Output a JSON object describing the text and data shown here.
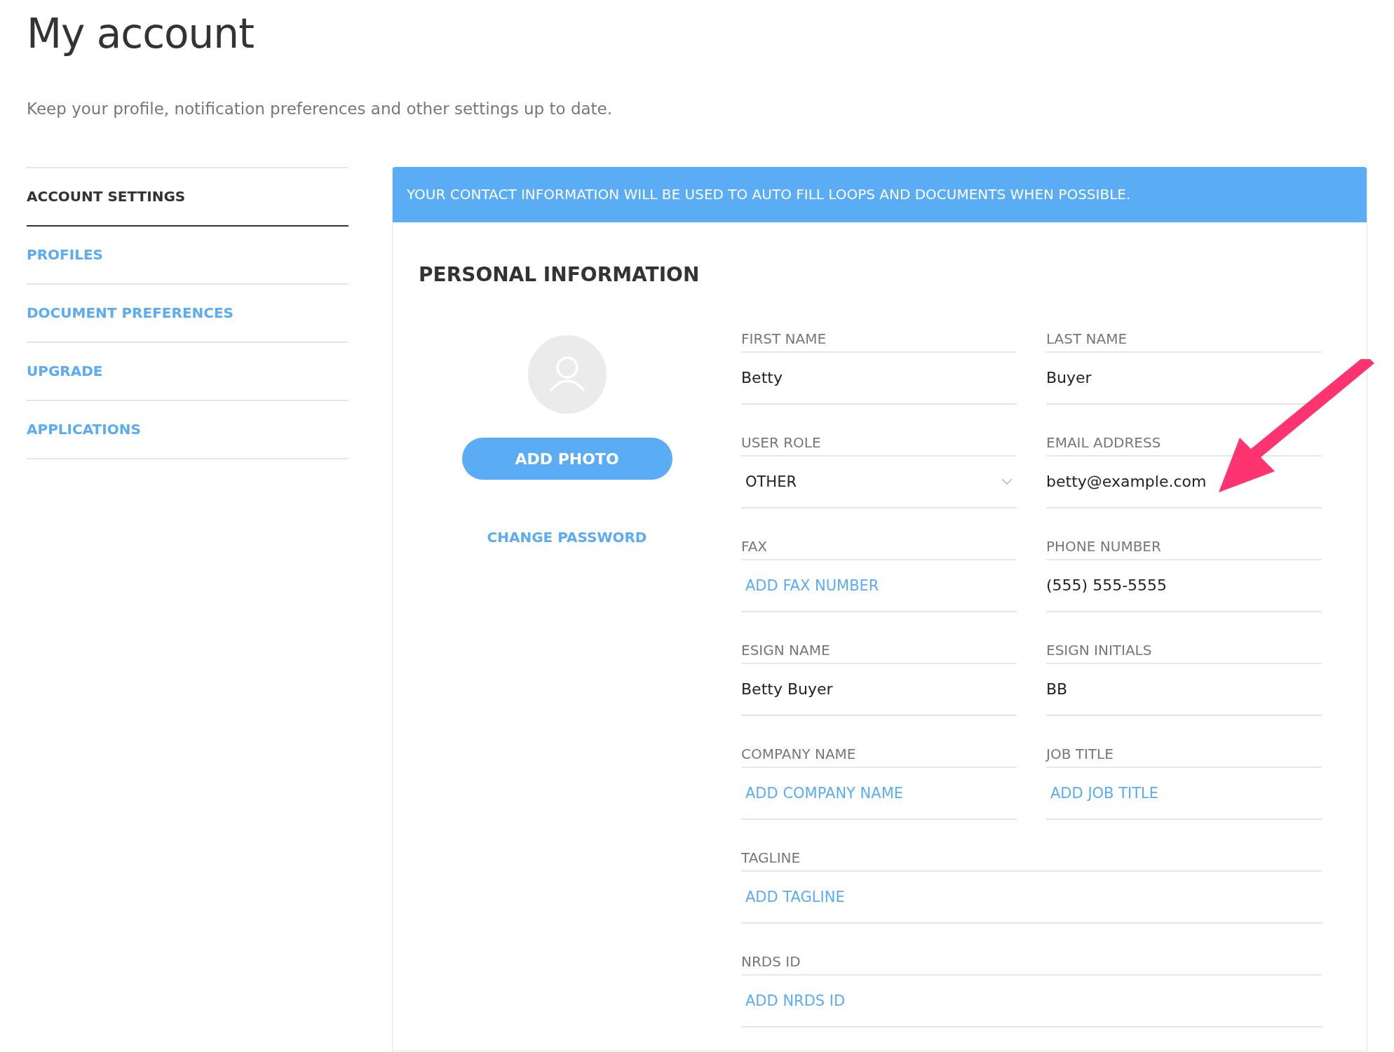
{
  "page": {
    "title": "My account",
    "subtitle": "Keep your profile, notification preferences and other settings up to date."
  },
  "sidebar": {
    "items": [
      {
        "label": "ACCOUNT SETTINGS",
        "selected": true
      },
      {
        "label": "PROFILES",
        "selected": false
      },
      {
        "label": "DOCUMENT PREFERENCES",
        "selected": false
      },
      {
        "label": "UPGRADE",
        "selected": false
      },
      {
        "label": "APPLICATIONS",
        "selected": false
      }
    ]
  },
  "banner": "YOUR CONTACT INFORMATION WILL BE USED TO AUTO FILL LOOPS AND DOCUMENTS WHEN POSSIBLE.",
  "section": {
    "title": "PERSONAL INFORMATION",
    "add_photo": "ADD PHOTO",
    "change_password": "CHANGE PASSWORD",
    "fields": [
      {
        "kind": "text",
        "label": "FIRST NAME",
        "value": "Betty",
        "wide": false
      },
      {
        "kind": "text",
        "label": "LAST NAME",
        "value": "Buyer",
        "wide": false
      },
      {
        "kind": "select",
        "label": "USER ROLE",
        "value": "OTHER",
        "wide": false
      },
      {
        "kind": "text",
        "label": "EMAIL ADDRESS",
        "value": "betty@example.com",
        "wide": false
      },
      {
        "kind": "text",
        "label": "FAX",
        "placeholder": "ADD FAX NUMBER",
        "wide": false
      },
      {
        "kind": "text",
        "label": "PHONE NUMBER",
        "value": "(555) 555-5555",
        "wide": false
      },
      {
        "kind": "text",
        "label": "ESIGN NAME",
        "value": "Betty Buyer",
        "wide": false
      },
      {
        "kind": "text",
        "label": "ESIGN INITIALS",
        "value": "BB",
        "wide": false
      },
      {
        "kind": "text",
        "label": "COMPANY NAME",
        "placeholder": "ADD COMPANY NAME",
        "wide": false
      },
      {
        "kind": "text",
        "label": "JOB TITLE",
        "placeholder": "ADD JOB TITLE",
        "wide": false
      },
      {
        "kind": "text",
        "label": "TAGLINE",
        "placeholder": "ADD TAGLINE",
        "wide": true
      },
      {
        "kind": "text",
        "label": "NRDS ID",
        "placeholder": "ADD NRDS ID",
        "wide": true
      }
    ]
  }
}
